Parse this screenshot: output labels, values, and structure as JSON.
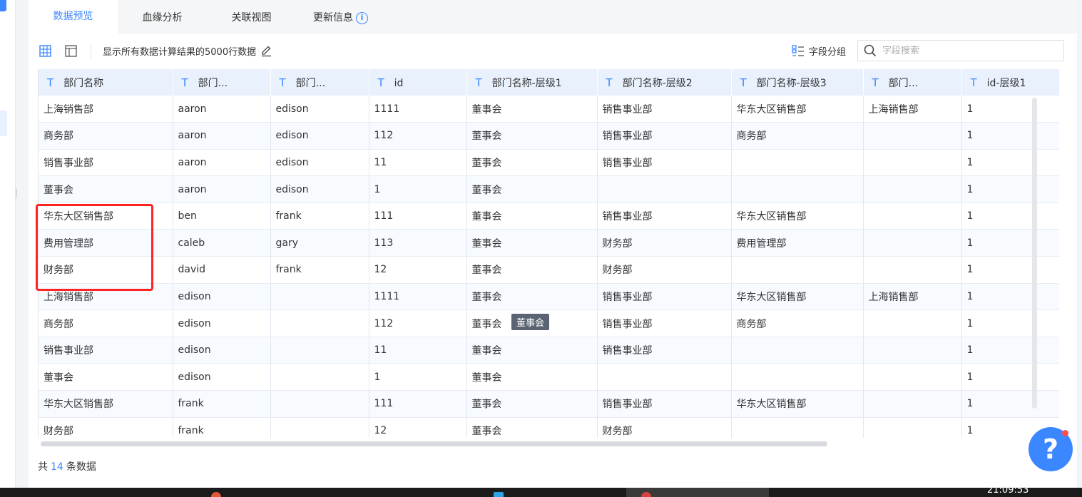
{
  "tabs": [
    {
      "label": "数据预览"
    },
    {
      "label": "血缘分析"
    },
    {
      "label": "关联视图"
    },
    {
      "label": "更新信息"
    }
  ],
  "toolbar": {
    "info_text": "显示所有数据计算结果的5000行数据",
    "group_label": "字段分组",
    "search_placeholder": "字段搜索"
  },
  "table": {
    "type_icon": "T",
    "columns": [
      "部门名称",
      "部门...",
      "部门...",
      "id",
      "部门名称-层级1",
      "部门名称-层级2",
      "部门名称-层级3",
      "部门...",
      "id-层级1"
    ],
    "rows": [
      [
        "上海销售部",
        "aaron",
        "edison",
        "1111",
        "董事会",
        "销售事业部",
        "华东大区销售部",
        "上海销售部",
        "1"
      ],
      [
        "商务部",
        "aaron",
        "edison",
        "112",
        "董事会",
        "销售事业部",
        "商务部",
        "",
        "1"
      ],
      [
        "销售事业部",
        "aaron",
        "edison",
        "11",
        "董事会",
        "销售事业部",
        "",
        "",
        "1"
      ],
      [
        "董事会",
        "aaron",
        "edison",
        "1",
        "董事会",
        "",
        "",
        "",
        "1"
      ],
      [
        "华东大区销售部",
        "ben",
        "frank",
        "111",
        "董事会",
        "销售事业部",
        "华东大区销售部",
        "",
        "1"
      ],
      [
        "费用管理部",
        "caleb",
        "gary",
        "113",
        "董事会",
        "财务部",
        "费用管理部",
        "",
        "1"
      ],
      [
        "财务部",
        "david",
        "frank",
        "12",
        "董事会",
        "财务部",
        "",
        "",
        "1"
      ],
      [
        "上海销售部",
        "edison",
        "",
        "1111",
        "董事会",
        "销售事业部",
        "华东大区销售部",
        "上海销售部",
        "1"
      ],
      [
        "商务部",
        "edison",
        "",
        "112",
        "董事会",
        "销售事业部",
        "商务部",
        "",
        "1"
      ],
      [
        "销售事业部",
        "edison",
        "",
        "11",
        "董事会",
        "销售事业部",
        "",
        "",
        "1"
      ],
      [
        "董事会",
        "edison",
        "",
        "1",
        "董事会",
        "",
        "",
        "",
        "1"
      ],
      [
        "华东大区销售部",
        "frank",
        "",
        "111",
        "董事会",
        "销售事业部",
        "华东大区销售部",
        "",
        "1"
      ],
      [
        "财务部",
        "frank",
        "",
        "12",
        "董事会",
        "财务部",
        "",
        "",
        "1"
      ]
    ]
  },
  "tooltip": {
    "text": "董事会"
  },
  "footer": {
    "prefix": "共",
    "count": "14",
    "suffix": "条数据"
  },
  "help": {
    "symbol": "?"
  },
  "taskbar": {
    "clock": "21:09:53"
  },
  "colors": {
    "accent": "#3b87ff",
    "highlight": "#ff2424",
    "header_bg": "#e9f1fc"
  },
  "icons": {
    "grid_view": "grid-view-icon",
    "table_view": "table-view-icon",
    "edit": "edit-icon",
    "group": "group-icon",
    "search": "search-icon",
    "info": "info-icon",
    "help": "help-icon"
  }
}
